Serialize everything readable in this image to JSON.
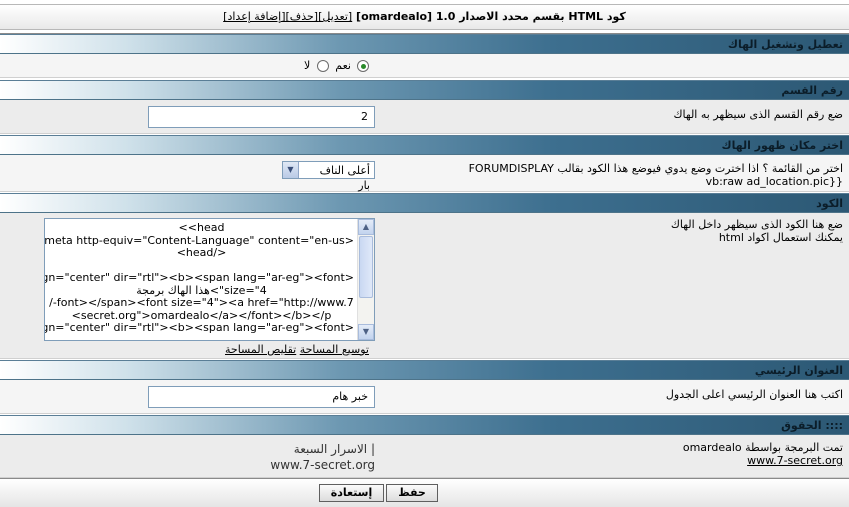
{
  "title": {
    "text": "كود HTML بقسم محدد الاصدار 1.0 [omardealo]",
    "links": [
      "[تعديل]",
      "[حذف]",
      "[إضافة إعداد]"
    ]
  },
  "sections": {
    "toggle": {
      "header": "تعطيل وتشغيل الهاك",
      "yes_label": "نعم",
      "no_label": "لا",
      "selected": "yes"
    },
    "forum": {
      "header": "رقم القسم",
      "label": "ضع رقم القسم الذى سيظهر به الهاك",
      "value": "2"
    },
    "location": {
      "header": "اختر مكان ظهور الهاك",
      "label_line1": "اختر من القائمة ؟ اذا اخترت وضع يدوي فيوضع هذا الكود بقالب FORUMDISPLAY",
      "label_line2": "{{vb:raw ad_location.pic",
      "selected_option": "أعلى الناف بار"
    },
    "code": {
      "header": "الكود",
      "label_line1": "ضع هنا الكود الذى سيظهر داخل الهاك",
      "label_line2": "يمكنك استعمال اكواد html",
      "lines": [
        "head>>",
        "<meta http-equiv=\"Content-Language\" content=\"en-us\">",
        "</head>",
        "",
        "<p align=\"center\" dir=\"rtl\"><b><span lang=\"ar-eg\"><font",
        "size=\"4\">هذا الهاك برمجة",
        "font></span><font size=\"4\"><a href=\"http://www.7-/",
        "secret.org\">omardealo</a></font></b></p>",
        "<p align=\"center\" dir=\"rtl\"><b><span lang=\"ar-eg\"><font"
      ],
      "expand_link": "توسيع المساحة",
      "shrink_link": "تقليص المساحة"
    },
    "main_title": {
      "header": "العنوان الرئيسي",
      "label": "اكتب هنا العنوان الرئيسي اعلى الجدول",
      "value": "خبر هام"
    },
    "rights": {
      "header": ":::: الحقوق",
      "label_line1": "تمت البرمجة بواسطة omardealo",
      "label_link": "www.7-secret.org",
      "credit_line1": "| الاسرار السبعة",
      "credit_line2": "www.7-secret.org"
    }
  },
  "footer": {
    "save_label": "حفظ",
    "reset_label": "إستعادة"
  },
  "icons": {
    "select_arrow": "chevron-down-icon",
    "scroll_up": "arrow-up-icon",
    "scroll_down": "arrow-down-icon"
  }
}
